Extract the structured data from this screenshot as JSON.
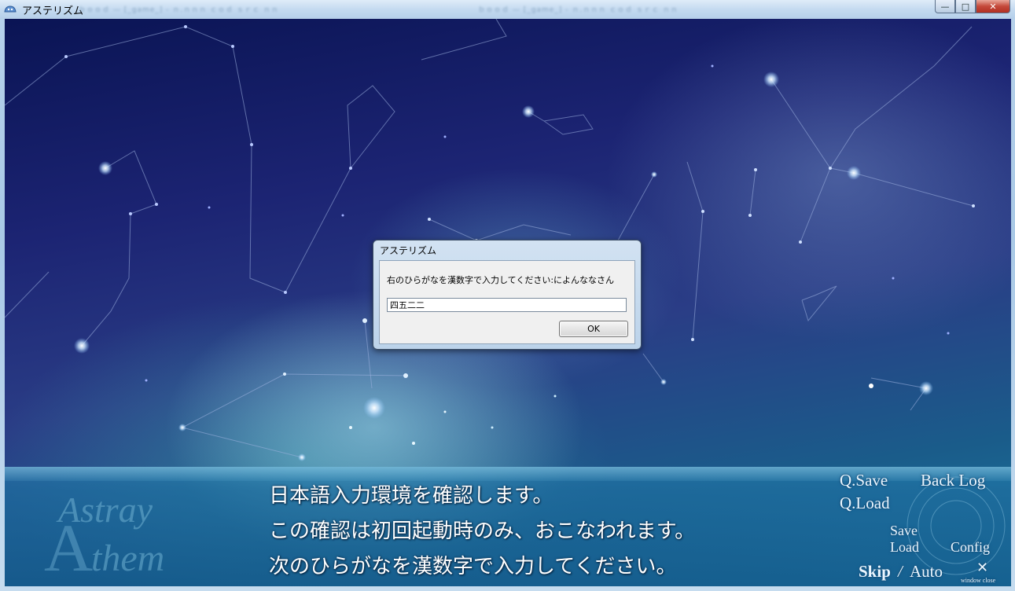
{
  "window": {
    "title": "アステリズム",
    "ghost_tab_1": "ｂｏｏｄ — [_game_] - ｎ.ｎｎｎ ｃｏｄ ｓｒｃ ｎｎ",
    "ghost_tab_2": "ｂｏｏｄ — [_game_] - ｎ.ｎｎｎ ｃｏｄ ｓｒｃ ｎｎ",
    "minimize_glyph": "—",
    "maximize_glyph": "□",
    "close_glyph": "✕"
  },
  "dialog": {
    "title": "アステリズム",
    "prompt": "右のひらがなを漢数字で入力してください:によんななさん",
    "input_value": "四五二二",
    "ok_label": "OK"
  },
  "message": {
    "lines": [
      "日本語入力環境を確認します。",
      "この確認は初回起動時のみ、おこなわれます。",
      "次のひらがなを漢数字で入力してください。"
    ]
  },
  "logo": {
    "line1": "Astray",
    "line2": "Athem"
  },
  "menu": {
    "qsave": "Q.Save",
    "qload": "Q.Load",
    "backlog": "Back Log",
    "save": "Save",
    "load": "Load",
    "config": "Config",
    "skip": "Skip",
    "separator": "/",
    "auto": "Auto",
    "window_close_glyph": "✕",
    "window_close_label": "window close"
  },
  "colors": {
    "sky_top": "#0a1454",
    "sky_bottom": "#1c7aa0",
    "message_text": "#ffffff",
    "menu_text": "#eaf6ff"
  }
}
